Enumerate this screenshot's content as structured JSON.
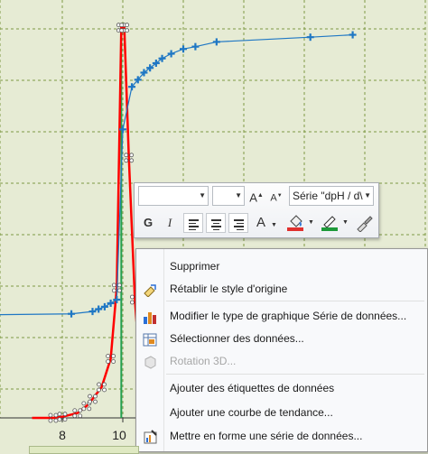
{
  "chart_data": {
    "type": "scatter",
    "x_ticks": [
      "8",
      "10"
    ],
    "series": [
      {
        "color": "#1f77c4",
        "marker": "plus",
        "points": [
          [
            8.3,
            4.4
          ],
          [
            9.0,
            4.5
          ],
          [
            9.2,
            4.6
          ],
          [
            9.4,
            4.7
          ],
          [
            9.6,
            4.85
          ],
          [
            9.8,
            5.0
          ],
          [
            10.0,
            12.2
          ],
          [
            10.3,
            14.0
          ],
          [
            10.5,
            14.3
          ],
          [
            10.7,
            14.6
          ],
          [
            10.9,
            14.8
          ],
          [
            11.1,
            15.0
          ],
          [
            11.3,
            15.2
          ],
          [
            11.6,
            15.4
          ],
          [
            12.0,
            15.6
          ],
          [
            12.4,
            15.7
          ],
          [
            13.1,
            15.9
          ],
          [
            16.2,
            16.1
          ],
          [
            17.6,
            16.2
          ]
        ]
      },
      {
        "color": "#ff0000",
        "points": [
          [
            7.0,
            0.0
          ],
          [
            7.7,
            0.0
          ],
          [
            8.0,
            0.05
          ],
          [
            8.5,
            0.2
          ],
          [
            8.8,
            0.5
          ],
          [
            9.0,
            0.8
          ],
          [
            9.3,
            1.3
          ],
          [
            9.6,
            2.5
          ],
          [
            9.8,
            5.5
          ],
          [
            9.95,
            16.5
          ],
          [
            10.05,
            16.5
          ],
          [
            10.2,
            11.0
          ],
          [
            10.4,
            5.0
          ],
          [
            10.6,
            1.5
          ]
        ]
      }
    ],
    "vline": {
      "x": 9.95,
      "color": "#22a050"
    }
  },
  "toolbar": {
    "font_value": "",
    "size_value": "",
    "grow_label": "A",
    "shrink_label": "A",
    "series_value": "Série \"dpH / d\\",
    "bold_label": "G",
    "italic_label": "I",
    "fontcolor_label": "A",
    "fill_color": "#e0302e",
    "line_color": "#1e9a3a"
  },
  "menu": {
    "items": [
      {
        "name": "supprimer",
        "label": "Supprimer",
        "icon": "",
        "disabled": false
      },
      {
        "name": "retablir-style",
        "label": "Rétablir le style d'origine",
        "icon": "reset-style-icon",
        "disabled": false
      },
      {
        "name": "modifier-type",
        "label": "Modifier le type de graphique Série de données...",
        "icon": "chart-type-icon",
        "disabled": false
      },
      {
        "name": "selectionner-donnees",
        "label": "Sélectionner des données...",
        "icon": "select-data-icon",
        "disabled": false
      },
      {
        "name": "rotation-3d",
        "label": "Rotation 3D...",
        "icon": "rotation-3d-icon",
        "disabled": true
      },
      {
        "name": "ajouter-etiquettes",
        "label": "Ajouter des étiquettes de données",
        "icon": "",
        "disabled": false
      },
      {
        "name": "ajouter-tendance",
        "label": "Ajouter une courbe de tendance...",
        "icon": "",
        "disabled": false
      },
      {
        "name": "mettre-en-forme",
        "label": "Mettre en forme une série de données...",
        "icon": "format-series-icon",
        "disabled": false
      }
    ]
  }
}
